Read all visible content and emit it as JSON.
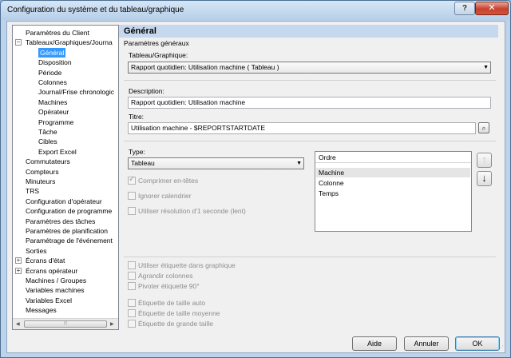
{
  "window": {
    "title": "Configuration du système et du tableau/graphique",
    "help_label": "?",
    "close_label": "✕"
  },
  "tree": {
    "items": [
      {
        "label": "Paramètres du Client",
        "expander": ""
      },
      {
        "label": "Tableaux/Graphiques/Journa",
        "expander": "−"
      },
      {
        "label": "Général",
        "expander": "",
        "selected": true
      },
      {
        "label": "Disposition",
        "expander": ""
      },
      {
        "label": "Période",
        "expander": ""
      },
      {
        "label": "Colonnes",
        "expander": ""
      },
      {
        "label": "Journal/Frise chronologic",
        "expander": ""
      },
      {
        "label": "Machines",
        "expander": ""
      },
      {
        "label": "Opérateur",
        "expander": ""
      },
      {
        "label": "Programme",
        "expander": ""
      },
      {
        "label": "Tâche",
        "expander": ""
      },
      {
        "label": "Cibles",
        "expander": ""
      },
      {
        "label": "Export Excel",
        "expander": ""
      },
      {
        "label": "Commutateurs",
        "expander": ""
      },
      {
        "label": "Compteurs",
        "expander": ""
      },
      {
        "label": "Minuteurs",
        "expander": ""
      },
      {
        "label": "TRS",
        "expander": ""
      },
      {
        "label": "Configuration d'opérateur",
        "expander": ""
      },
      {
        "label": "Configuration de programme",
        "expander": ""
      },
      {
        "label": "Paramètres des tâches",
        "expander": ""
      },
      {
        "label": "Paramètres de planification",
        "expander": ""
      },
      {
        "label": "Paramétrage de l'événement",
        "expander": ""
      },
      {
        "label": "Sorties",
        "expander": ""
      },
      {
        "label": "Écrans d'état",
        "expander": "+"
      },
      {
        "label": "Écrans opérateur",
        "expander": "+"
      },
      {
        "label": "Machines / Groupes",
        "expander": ""
      },
      {
        "label": "Variables machines",
        "expander": ""
      },
      {
        "label": "Variables Excel",
        "expander": ""
      },
      {
        "label": "Messages",
        "expander": ""
      }
    ],
    "scroll_thumb_label": "⦙⦙⦙"
  },
  "panel": {
    "header": "Général",
    "general_params": "Paramètres généraux",
    "table_graph_label": "Tableau/Graphique:",
    "table_graph_value": "Rapport quotidien: Utilisation machine  ( Tableau )",
    "description_label": "Description:",
    "description_value": "Rapport quotidien: Utilisation machine",
    "title_label": "Titre:",
    "title_value": "Utilisation machine - $REPORTSTARTDATE",
    "type_label": "Type:",
    "type_value": "Tableau",
    "order_header": "Ordre",
    "order_items": [
      "Machine",
      "Colonne",
      "Temps"
    ],
    "up_label": "↑",
    "down_label": "↓",
    "options": [
      {
        "label": "Comprimer en-têtes",
        "checked": true
      },
      {
        "label": "Ignorer calendrier",
        "checked": false
      },
      {
        "label": "Utiliser résolution d'1 seconde (lent)",
        "checked": false
      }
    ],
    "chart_options": [
      {
        "label": "Utiliser étiquette dans graphique",
        "checked": false
      },
      {
        "label": "Agrandir colonnes",
        "checked": false
      },
      {
        "label": "Pivoter étiquette 90°",
        "checked": false
      }
    ],
    "label_size_options": [
      {
        "label": "Étiquette de taille auto",
        "checked": false
      },
      {
        "label": "Étiquette de taille moyenne",
        "checked": false
      },
      {
        "label": "Étiquette de grande taille",
        "checked": false
      }
    ]
  },
  "buttons": {
    "help": "Aide",
    "cancel": "Annuler",
    "ok": "OK"
  }
}
